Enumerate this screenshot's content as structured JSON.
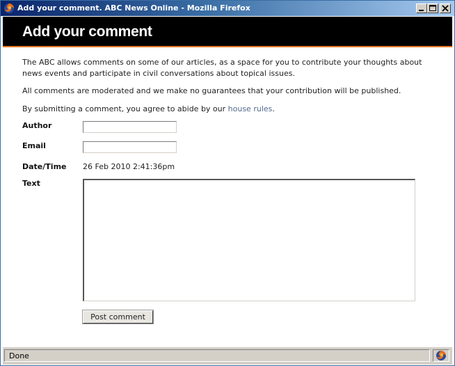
{
  "window": {
    "title": "Add your comment. ABC News Online - Mozilla Firefox",
    "app_icon": "firefox-icon",
    "controls": [
      "minimize-icon",
      "maximize-icon",
      "close-icon"
    ]
  },
  "header": {
    "title": "Add your comment",
    "accent_color": "#e87722",
    "background": "#000000"
  },
  "intro": {
    "p1": "The ABC allows comments on some of our articles, as a space for you to contribute your thoughts about news events and participate in civil conversations about topical issues.",
    "p2": "All comments are moderated and we make no guarantees that your contribution will be published.",
    "p3_prefix": "By submitting a comment, you agree to abide by our ",
    "p3_link": "house rules",
    "p3_suffix": "."
  },
  "form": {
    "author_label": "Author",
    "author_value": "",
    "email_label": "Email",
    "email_value": "",
    "datetime_label": "Date/Time",
    "datetime_value": "26 Feb 2010 2:41:36pm",
    "text_label": "Text",
    "text_value": "",
    "submit_label": "Post comment"
  },
  "status": {
    "text": "Done",
    "icon": "firefox-icon"
  }
}
